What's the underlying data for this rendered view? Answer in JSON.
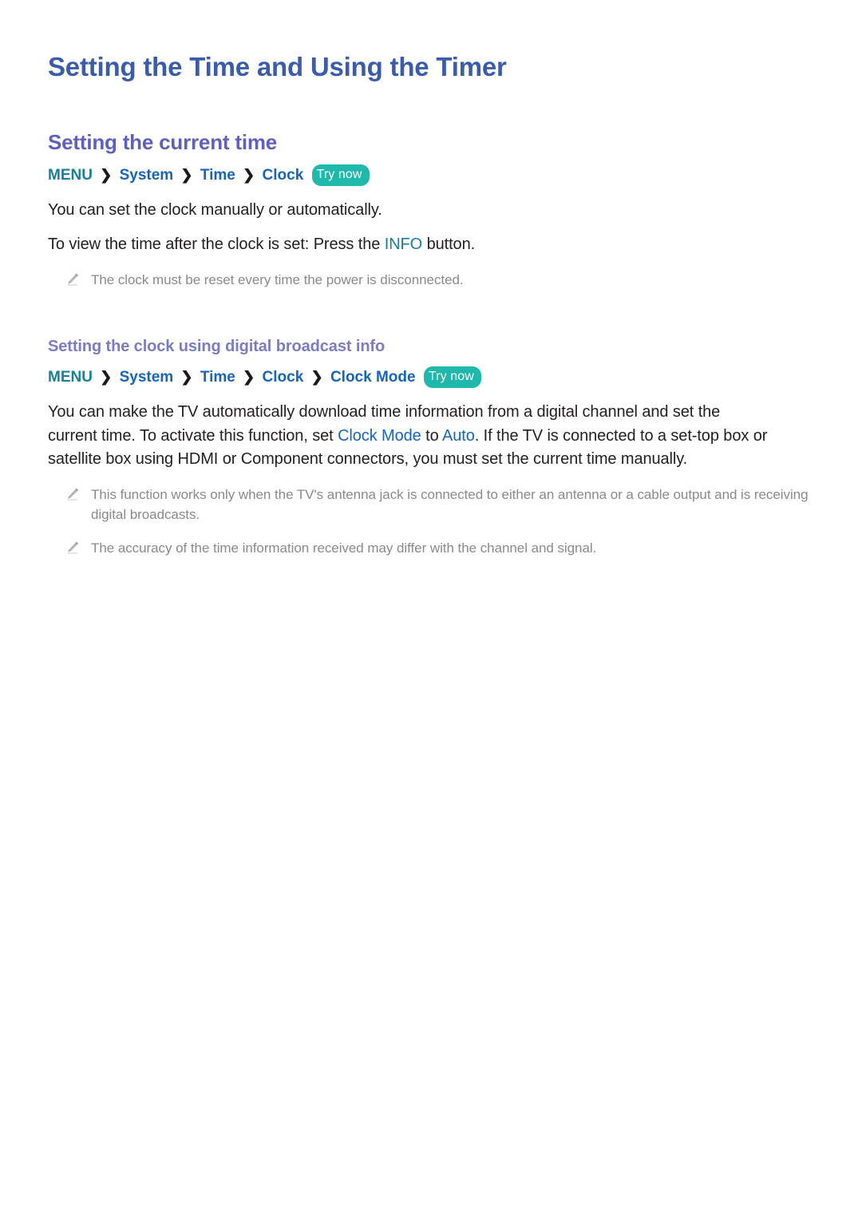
{
  "document": {
    "title": "Setting the Time and Using the Timer"
  },
  "colors": {
    "title": "#3a5cab",
    "heading2": "#5f5fc0",
    "heading3": "#7b7bc8",
    "menu_accent": "#17809a",
    "link_blue": "#1565c0",
    "badge_teal": "#1eb9ab",
    "body_text": "#231f20",
    "note_text": "#8a8a8a"
  },
  "sections": [
    {
      "heading": "Setting the current time",
      "breadcrumb": {
        "root": "MENU",
        "separator": "❯",
        "items": [
          "System",
          "Time",
          "Clock"
        ],
        "badge": "Try now"
      },
      "paragraphs": [
        {
          "parts": [
            {
              "text": "You can set the clock manually or automatically.",
              "style": "plain"
            }
          ]
        },
        {
          "parts": [
            {
              "text": "To view the time after the clock is set: Press the ",
              "style": "plain"
            },
            {
              "text": "INFO",
              "style": "teal"
            },
            {
              "text": " button.",
              "style": "plain"
            }
          ]
        }
      ],
      "notes": [
        {
          "icon": "pencil-icon",
          "text": "The clock must be reset every time the power is disconnected."
        }
      ]
    },
    {
      "heading": "Setting the clock using digital broadcast info",
      "breadcrumb": {
        "root": "MENU",
        "separator": "❯",
        "items": [
          "System",
          "Time",
          "Clock",
          "Clock Mode"
        ],
        "badge": "Try now"
      },
      "paragraphs": [
        {
          "parts": [
            {
              "text": "You can make the TV automatically download time information from a digital channel and set the current time. To activate this function, set ",
              "style": "plain"
            },
            {
              "text": "Clock Mode",
              "style": "blue"
            },
            {
              "text": " to ",
              "style": "plain"
            },
            {
              "text": "Auto",
              "style": "blue"
            },
            {
              "text": ". If the TV is connected to a set-top box or satellite box using HDMI or Component connectors, you must set the current time manually.",
              "style": "plain"
            }
          ]
        }
      ],
      "notes": [
        {
          "icon": "pencil-icon",
          "text": "This function works only when the TV's antenna jack is connected to either an antenna or a cable output and is receiving digital broadcasts."
        },
        {
          "icon": "pencil-icon",
          "text": "The accuracy of the time information received may differ with the channel and signal."
        }
      ]
    }
  ]
}
